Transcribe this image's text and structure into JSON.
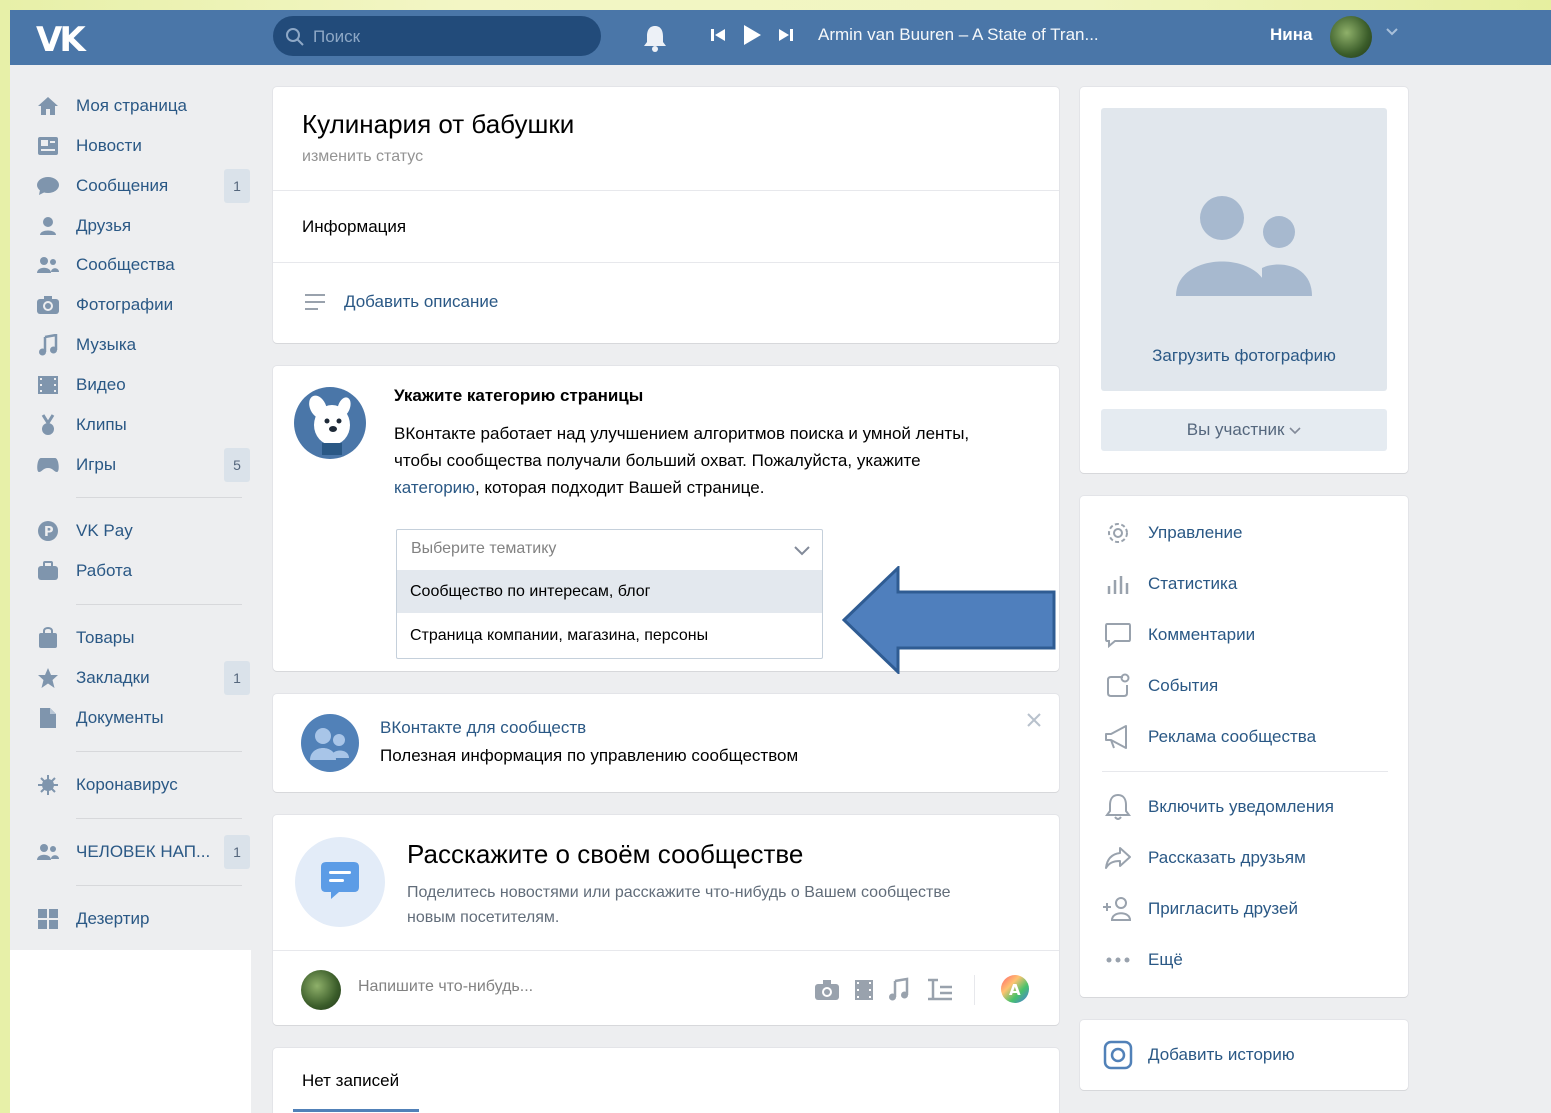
{
  "header": {
    "logo": "VK",
    "search_placeholder": "Поиск",
    "track": "Armin van Buuren – A State of Tran...",
    "user_name": "Нина"
  },
  "left_menu": [
    {
      "label": "Моя страница",
      "icon": "home-icon"
    },
    {
      "label": "Новости",
      "icon": "news-icon"
    },
    {
      "label": "Сообщения",
      "icon": "messages-icon",
      "count": "1"
    },
    {
      "label": "Друзья",
      "icon": "friends-icon"
    },
    {
      "label": "Сообщества",
      "icon": "communities-icon"
    },
    {
      "label": "Фотографии",
      "icon": "camera-icon"
    },
    {
      "label": "Музыка",
      "icon": "music-icon"
    },
    {
      "label": "Видео",
      "icon": "video-icon"
    },
    {
      "label": "Клипы",
      "icon": "clips-icon"
    },
    {
      "label": "Игры",
      "icon": "games-icon",
      "count": "5"
    },
    {
      "label": "VK Pay",
      "icon": "vkpay-icon"
    },
    {
      "label": "Работа",
      "icon": "work-icon"
    },
    {
      "label": "Товары",
      "icon": "goods-icon"
    },
    {
      "label": "Закладки",
      "icon": "bookmarks-icon",
      "count": "1"
    },
    {
      "label": "Документы",
      "icon": "documents-icon"
    },
    {
      "label": "Коронавирус",
      "icon": "coronavirus-icon"
    },
    {
      "label": "ЧЕЛОВЕК НАП...",
      "icon": "group-icon",
      "count": "1"
    },
    {
      "label": "Дезертир",
      "icon": "apps-icon"
    }
  ],
  "community": {
    "title": "Кулинария от бабушки",
    "status": "изменить статус",
    "info_label": "Информация",
    "add_description": "Добавить описание"
  },
  "category": {
    "title": "Укажите категорию страницы",
    "text_before": "ВКонтакте работает над улучшением алгоритмов поиска и умной ленты, чтобы сообщества получали больший охват. Пожалуйста, укажите ",
    "link": "категорию",
    "text_after": ", которая подходит Вашей странице.",
    "select_placeholder": "Выберите тематику",
    "options": [
      "Сообщество по интересам, блог",
      "Страница компании, магазина, персоны"
    ]
  },
  "vk_for_communities": {
    "title": "ВКонтакте для сообществ",
    "subtitle": "Полезная информация по управлению сообществом"
  },
  "tell": {
    "title": "Расскажите о своём сообществе",
    "subtitle": "Поделитесь новостями или расскажите что-нибудь о Вашем сообществе новым посетителям.",
    "post_placeholder": "Напишите что-нибудь..."
  },
  "no_posts": "Нет записей",
  "right": {
    "upload_photo": "Загрузить фотографию",
    "member_button": "Вы участник",
    "actions": [
      {
        "label": "Управление",
        "icon": "gear-icon"
      },
      {
        "label": "Статистика",
        "icon": "stats-icon"
      },
      {
        "label": "Комментарии",
        "icon": "comment-icon"
      },
      {
        "label": "События",
        "icon": "events-icon"
      },
      {
        "label": "Реклама сообщества",
        "icon": "megaphone-icon"
      }
    ],
    "actions2": [
      {
        "label": "Включить уведомления",
        "icon": "bell-icon"
      },
      {
        "label": "Рассказать друзьям",
        "icon": "share-icon"
      },
      {
        "label": "Пригласить друзей",
        "icon": "invite-icon"
      },
      {
        "label": "Ещё",
        "icon": "more-icon"
      }
    ],
    "add_story": "Добавить историю"
  },
  "colors": {
    "header": "#4a76a8",
    "link": "#2a5885",
    "arrow": "#4f7fbd"
  }
}
